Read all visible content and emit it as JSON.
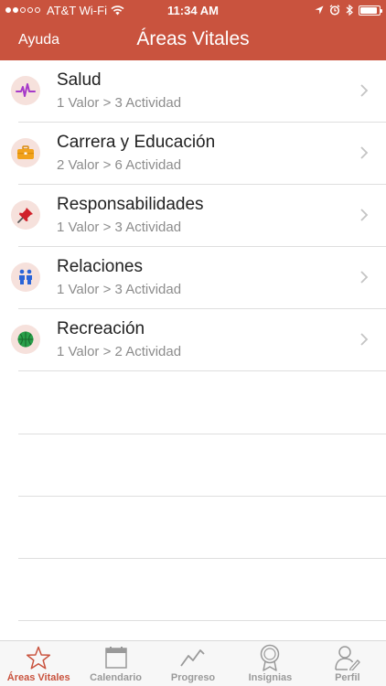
{
  "status_bar": {
    "carrier": "AT&T Wi-Fi",
    "time": "11:34 AM",
    "signal_bars": 2,
    "battery_level": 0.9,
    "icons": [
      "wifi-icon",
      "location-icon",
      "alarm-icon",
      "bluetooth-icon",
      "battery-icon"
    ]
  },
  "nav": {
    "help_label": "Ayuda",
    "title": "Áreas Vitales",
    "bar_color": "#c9533e"
  },
  "areas": [
    {
      "name": "Salud",
      "detail": "1 Valor > 3 Actividad",
      "icon": "heartbeat-icon",
      "color": "#a63ac9"
    },
    {
      "name": "Carrera y Educación",
      "detail": "2 Valor > 6 Actividad",
      "icon": "briefcase-icon",
      "color": "#f2a21b"
    },
    {
      "name": "Responsabilidades",
      "detail": "1 Valor > 3 Actividad",
      "icon": "pushpin-icon",
      "color": "#d0202a"
    },
    {
      "name": "Relaciones",
      "detail": "1 Valor > 3 Actividad",
      "icon": "people-icon",
      "color": "#2a64d8"
    },
    {
      "name": "Recreación",
      "detail": "1 Valor > 2 Actividad",
      "icon": "ball-icon",
      "color": "#2aa04a"
    }
  ],
  "tabs": [
    {
      "label": "Áreas Vitales",
      "icon": "star-icon",
      "active": true
    },
    {
      "label": "Calendario",
      "icon": "calendar-icon",
      "active": false
    },
    {
      "label": "Progreso",
      "icon": "chart-line-icon",
      "active": false
    },
    {
      "label": "Insignias",
      "icon": "badge-icon",
      "active": false
    },
    {
      "label": "Perfil",
      "icon": "profile-icon",
      "active": false
    }
  ],
  "accent_color": "#c9533e"
}
